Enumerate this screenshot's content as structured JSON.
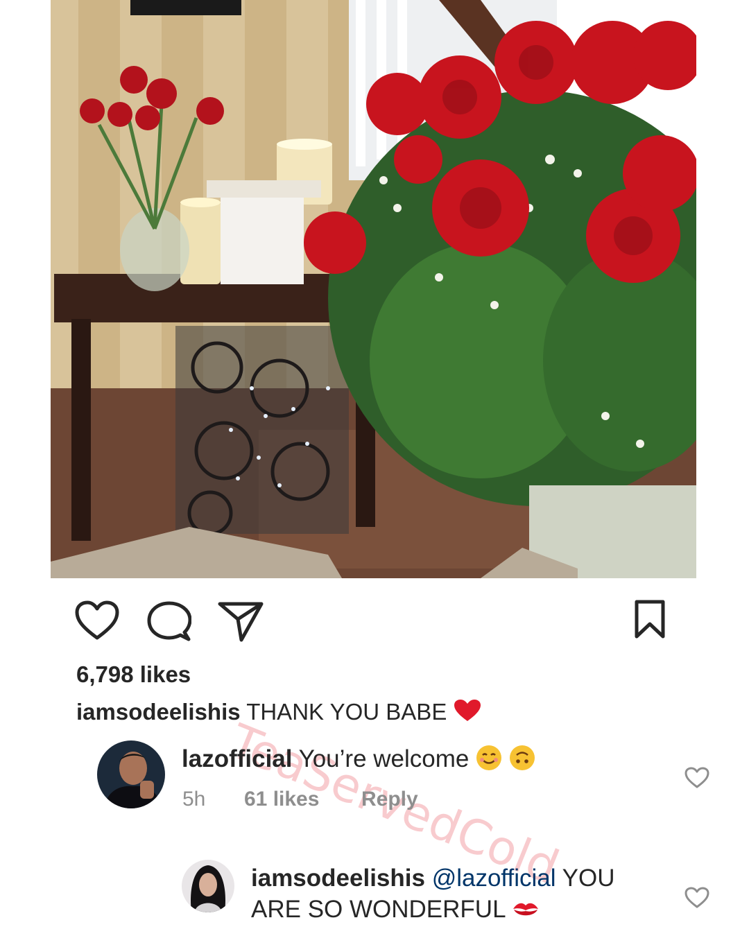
{
  "post": {
    "likes_text": "6,798 likes",
    "caption": {
      "username": "iamsodeelishis",
      "text": "THANK YOU BABE"
    }
  },
  "comments": [
    {
      "username": "lazofficial",
      "text": "You’re welcome",
      "time": "5h",
      "likes": "61 likes",
      "reply": "Reply"
    },
    {
      "username": "iamsodeelishis",
      "mention": "@lazofficial",
      "text_line1": "YOU",
      "text_line2": "ARE SO WONDERFUL"
    }
  ],
  "watermark": "TeaServedCold",
  "icons": {
    "like": "heart-outline-icon",
    "comment": "speech-bubble-icon",
    "share": "paper-plane-icon",
    "save": "bookmark-icon",
    "caption_emoji": "red-heart-emoji",
    "emoji_1": "smiling-face-emoji",
    "emoji_2": "upside-down-face-emoji",
    "emoji_3": "kiss-mark-emoji"
  },
  "colors": {
    "text": "#262626",
    "meta": "#8e8e8e",
    "mention": "#003569",
    "rose": "#c8141e"
  }
}
